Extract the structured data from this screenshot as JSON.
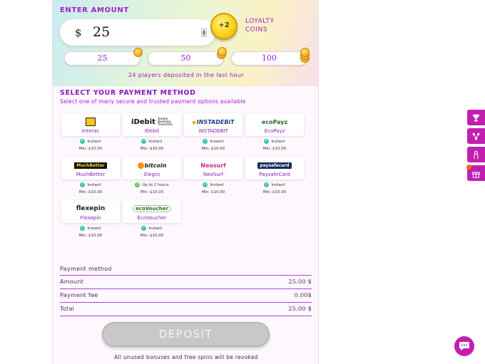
{
  "deposit": {
    "enter_amount_label": "ENTER AMOUNT",
    "currency_symbol": "$",
    "amount_value": "25",
    "loyalty_badge": "+2",
    "loyalty_label_1": "LOYALTY",
    "loyalty_label_2": "COINS",
    "presets": [
      "25",
      "50",
      "100"
    ],
    "deposited_note": "24 players deposited in the last hour"
  },
  "payment": {
    "title": "SELECT YOUR PAYMENT METHOD",
    "subtitle": "Select one of many secure and trusted payment options available",
    "methods": [
      {
        "name": "Interac",
        "logo": "Interac",
        "speed": "Instant",
        "min": "Min: $10.00"
      },
      {
        "name": "iDebit",
        "logo": "iDebit",
        "speed": "Instant",
        "min": "Min: $10.00"
      },
      {
        "name": "INSTADEBIT",
        "logo": "INSTADEBiT",
        "speed": "Instant",
        "min": "Min: $10.00"
      },
      {
        "name": "EcoPayz",
        "logo": "ecoPayz",
        "speed": "Instant",
        "min": "Min: $10.00"
      },
      {
        "name": "MuchBetter",
        "logo": "MuchBetter",
        "speed": "Instant",
        "min": "Min: $10.00"
      },
      {
        "name": "Elegro",
        "logo": "bitcoin",
        "speed": "Up to 2 hours",
        "min": "Min: $10.00"
      },
      {
        "name": "NeoSurf",
        "logo": "Neosurf",
        "speed": "Instant",
        "min": "Min: $10.00"
      },
      {
        "name": "PaysafeCard",
        "logo": "paysafecard",
        "speed": "Instant",
        "min": "Min: $10.00"
      },
      {
        "name": "Flexepin",
        "logo": "flexepin",
        "speed": "Instant",
        "min": "Min: $10.00"
      },
      {
        "name": "EcoVoucher",
        "logo": "ecoVoucher",
        "speed": "Instant",
        "min": "Min: $10.00"
      }
    ]
  },
  "summary": {
    "payment_method_label": "Payment method",
    "amount_label": "Amount",
    "amount_value": "25.00 $",
    "fee_label": "Payment fee",
    "fee_value": "0.00$",
    "total_label": "Total",
    "total_value": "25.00 $"
  },
  "deposit_button": "DEPOSIT",
  "bonus_warning": "All unused bonuses and free spins will be revoked",
  "colors": {
    "accent": "#a020c8",
    "side_tab": "#c21fb0",
    "instant_dot": "#3ec9a8"
  },
  "side_icons": [
    "trophy-icon",
    "network-icon",
    "person-icon",
    "gift-icon"
  ]
}
